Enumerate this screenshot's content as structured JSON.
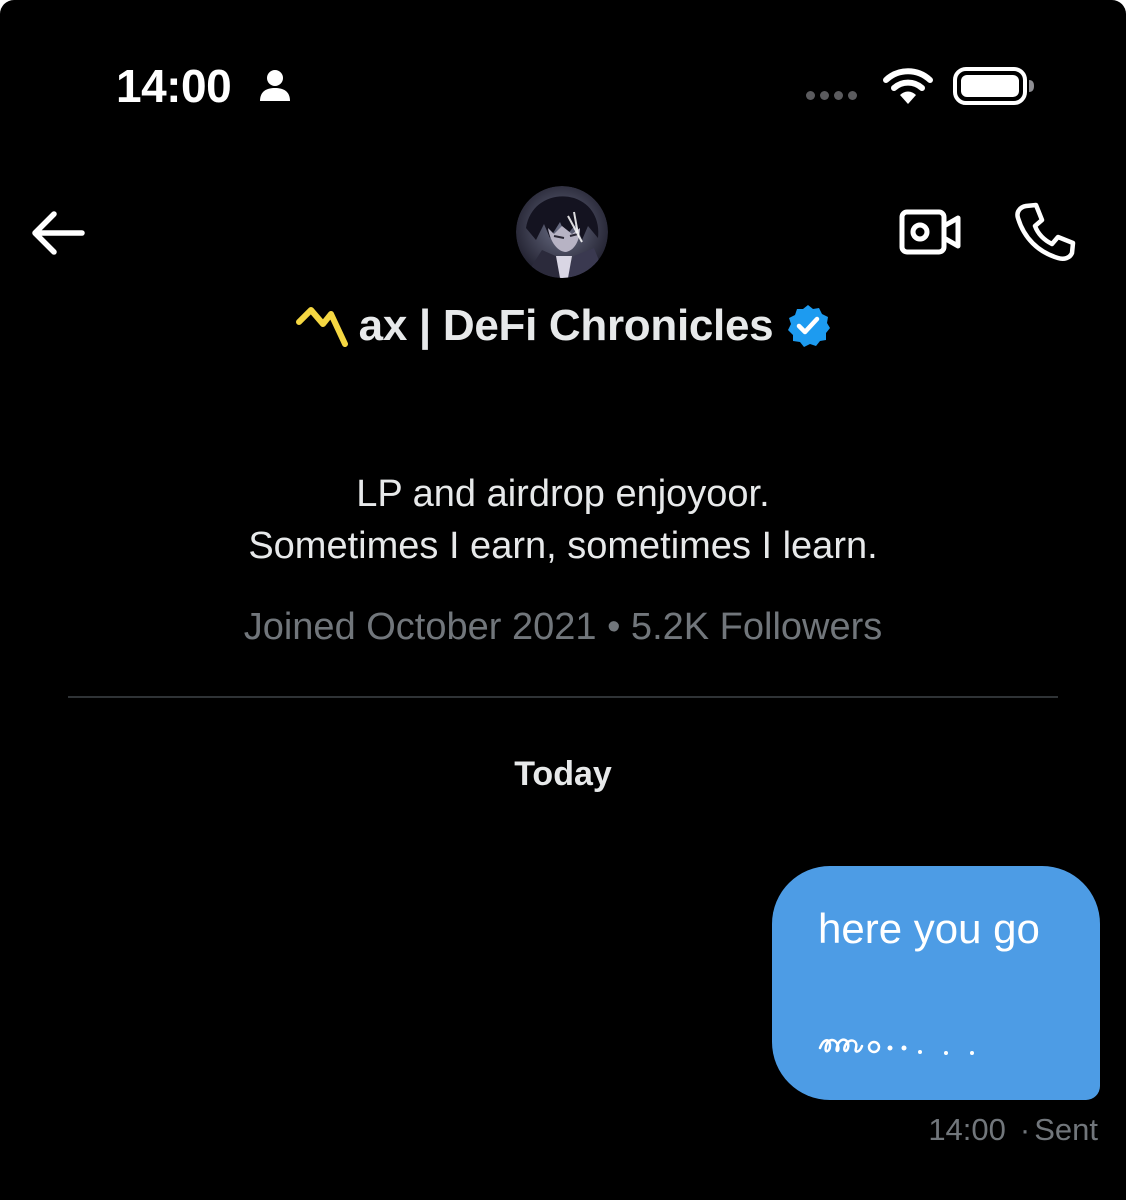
{
  "status_bar": {
    "time": "14:00",
    "person_icon": "person-icon",
    "signal_icon": "signal-dots-icon",
    "wifi_icon": "wifi-icon",
    "battery_icon": "battery-icon"
  },
  "header": {
    "back_icon": "arrow-left-icon",
    "video_call_icon": "video-camera-icon",
    "voice_call_icon": "phone-icon",
    "avatar_icon": "profile-avatar"
  },
  "profile": {
    "display_name": "ax | DeFi Chronicles",
    "verified": true,
    "bio_lines": [
      "LP and airdrop enjoyoor.",
      "Sometimes I earn, sometimes I learn."
    ],
    "meta": "Joined October 2021 • 5.2K Followers"
  },
  "conversation": {
    "date_separator": "Today",
    "messages": [
      {
        "direction": "outgoing",
        "text": "here you go",
        "time": "14:00",
        "status": "Sent"
      }
    ]
  },
  "colors": {
    "background": "#000000",
    "primary_text": "#e7e9ea",
    "secondary_text": "#71767b",
    "divider": "#2f3336",
    "outgoing_bubble": "#4d9ce5",
    "verified_badge": "#1d9bf0",
    "brand_logo": "#f5d742"
  }
}
